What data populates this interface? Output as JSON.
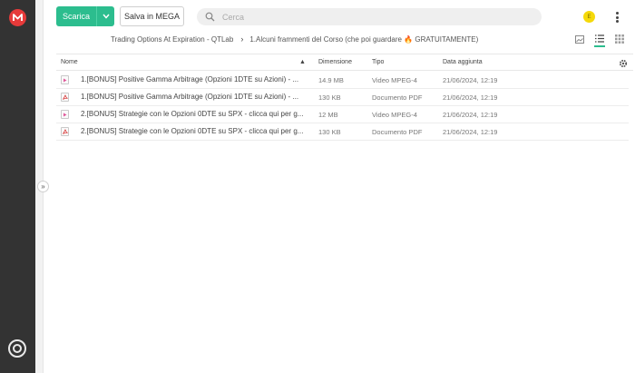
{
  "toolbar": {
    "download_label": "Scarica",
    "save_label": "Salva in MEGA",
    "search_placeholder": "Cerca",
    "avatar_initial": "E"
  },
  "breadcrumb": {
    "folder": "Trading Options At Expiration - QTLab",
    "subfolder": "1.Alcuni frammenti del Corso (che poi guardare 🔥 GRATUITAMENTE)"
  },
  "table": {
    "headers": {
      "name": "Nome",
      "size": "Dimensione",
      "type": "Tipo",
      "date": "Data aggiunta"
    },
    "rows": [
      {
        "icon": "video-file-icon",
        "name": "1.[BONUS] Positive Gamma Arbitrage (Opzioni 1DTE su Azioni) - ...",
        "size": "14.9 MB",
        "type": "Video MPEG-4",
        "date": "21/06/2024, 12:19"
      },
      {
        "icon": "pdf-file-icon",
        "name": "1.[BONUS] Positive Gamma Arbitrage (Opzioni 1DTE su Azioni) - ...",
        "size": "130 KB",
        "type": "Documento PDF",
        "date": "21/06/2024, 12:19"
      },
      {
        "icon": "video-file-icon",
        "name": "2.[BONUS] Strategie con le Opzioni 0DTE su SPX - clicca qui per g...",
        "size": "12 MB",
        "type": "Video MPEG-4",
        "date": "21/06/2024, 12:19"
      },
      {
        "icon": "pdf-file-icon",
        "name": "2.[BONUS] Strategie con le Opzioni 0DTE su SPX - clicca qui per g...",
        "size": "130 KB",
        "type": "Documento PDF",
        "date": "21/06/2024, 12:19"
      }
    ]
  },
  "colors": {
    "accent": "#2cbd8e",
    "brand": "#e63a3a",
    "rail": "#333333"
  }
}
